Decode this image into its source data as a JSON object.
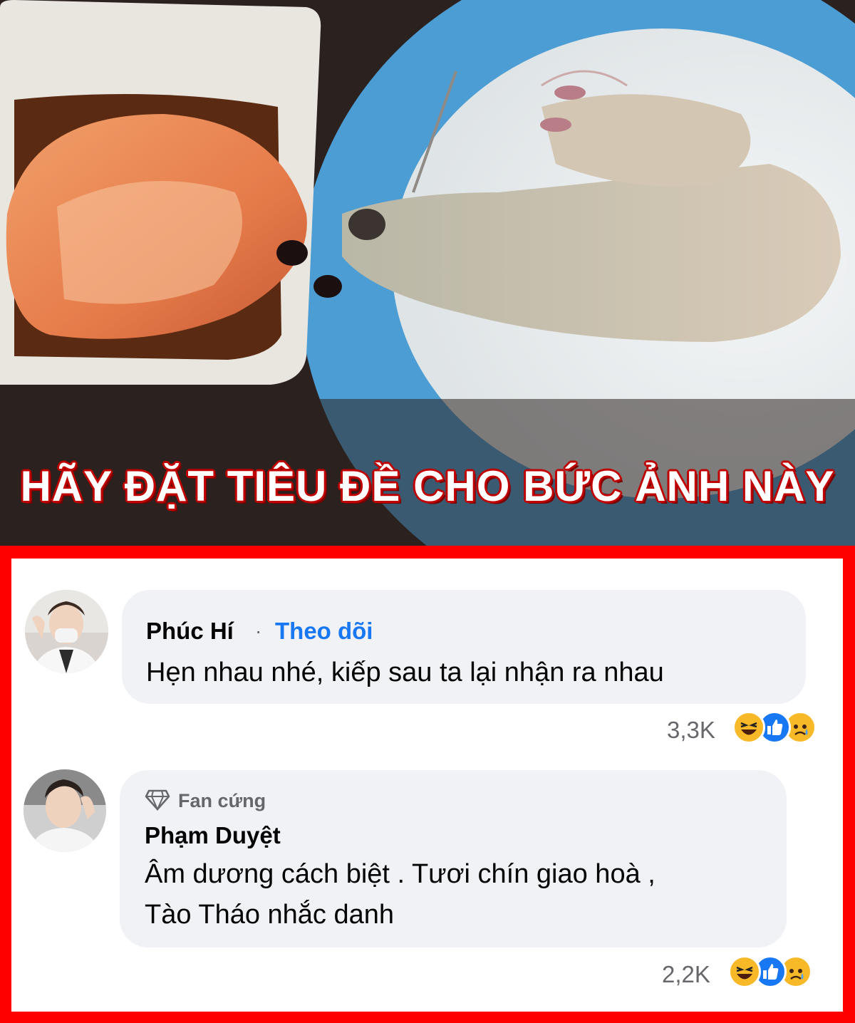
{
  "meme": {
    "headline": "HÃY ĐẶT TIÊU ĐỀ CHO BỨC ẢNH NÀY",
    "frame_color": "#ff0000",
    "headline_stroke_color": "#c00000"
  },
  "comments": [
    {
      "author": "Phúc Hí",
      "separator": "·",
      "follow_label": "Theo dõi",
      "text": "Hẹn nhau nhé, kiếp sau ta lại nhận ra nhau",
      "reaction_count": "3,3K",
      "reactions": [
        "haha-icon",
        "like-icon",
        "sad-icon"
      ]
    },
    {
      "badge": "Fan cứng",
      "badge_icon": "diamond-icon",
      "author": "Phạm Duyệt",
      "text_line1": "Âm dương cách biệt . Tươi chín giao hoà ,",
      "text_line2": "Tào Tháo nhắc danh",
      "reaction_count": "2,2K",
      "reactions": [
        "haha-icon",
        "like-icon",
        "sad-icon"
      ]
    }
  ],
  "colors": {
    "bubble": "#f0f2f5",
    "link_blue": "#1877f2",
    "meta_gray": "#65676b"
  }
}
